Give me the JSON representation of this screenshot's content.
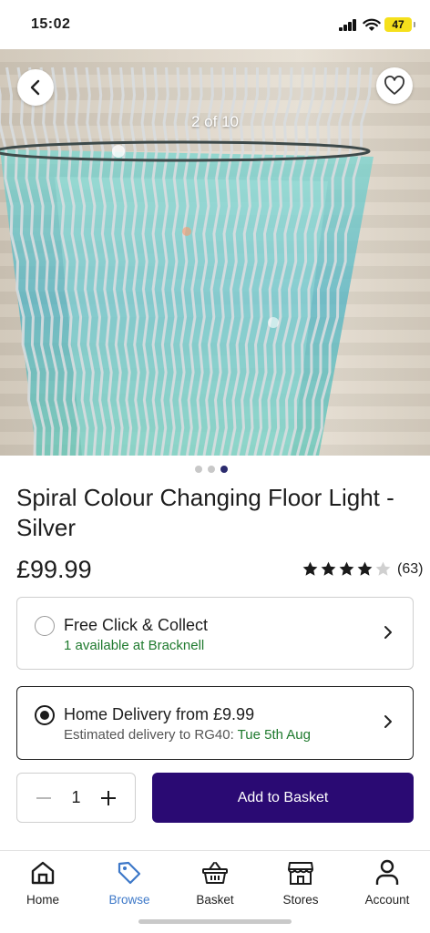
{
  "status_bar": {
    "time": "15:02",
    "battery": "47"
  },
  "gallery": {
    "counter": "2 of 10",
    "dots": [
      {
        "active": false
      },
      {
        "active": false
      },
      {
        "active": true
      }
    ]
  },
  "product": {
    "title": "Spiral Colour Changing Floor Light - Silver",
    "price": "£99.99",
    "rating": {
      "stars": 4,
      "max": 5,
      "count": "(63)"
    }
  },
  "fulfilment": {
    "collect": {
      "title": "Free Click & Collect",
      "subtitle": "1 available at Bracknell",
      "selected": false
    },
    "delivery": {
      "title": "Home Delivery from £9.99",
      "subtitle_prefix": "Estimated delivery to RG40: ",
      "subtitle_date": "Tue 5th Aug",
      "selected": true
    }
  },
  "quantity": {
    "value": "1"
  },
  "cta": {
    "add_label": "Add to Basket"
  },
  "tabbar": {
    "items": [
      {
        "label": "Home",
        "icon": "home-icon",
        "active": false
      },
      {
        "label": "Browse",
        "icon": "tag-icon",
        "active": true
      },
      {
        "label": "Basket",
        "icon": "basket-icon",
        "active": false
      },
      {
        "label": "Stores",
        "icon": "store-icon",
        "active": false
      },
      {
        "label": "Account",
        "icon": "account-icon",
        "active": false
      }
    ]
  },
  "colors": {
    "primary_button": "#2a0a73",
    "active_tab": "#3d78c8",
    "availability_green": "#1f7a2e"
  }
}
